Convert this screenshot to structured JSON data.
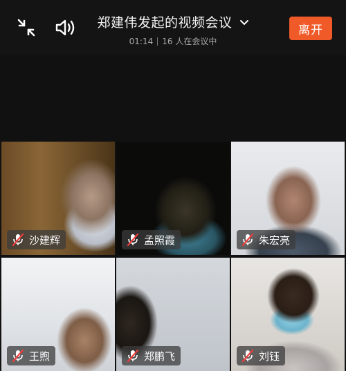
{
  "header": {
    "title": "郑建伟发起的视频会议",
    "duration": "01:14",
    "participants": "16 人在会议中",
    "leave_label": "离开"
  },
  "colors": {
    "accent": "#f05a28",
    "background": "#111111"
  },
  "participants": [
    {
      "name": "沙建辉",
      "mic": "muted"
    },
    {
      "name": "孟照霞",
      "mic": "muted"
    },
    {
      "name": "朱宏亮",
      "mic": "muted"
    },
    {
      "name": "王煦",
      "mic": "muted"
    },
    {
      "name": "郑鹏飞",
      "mic": "muted"
    },
    {
      "name": "刘钰",
      "mic": "muted"
    }
  ],
  "icons": {
    "minimize": "shrink-arrows-icon",
    "speaker": "speaker-icon",
    "dropdown": "chevron-down-icon",
    "mic": "mic-muted-icon"
  }
}
